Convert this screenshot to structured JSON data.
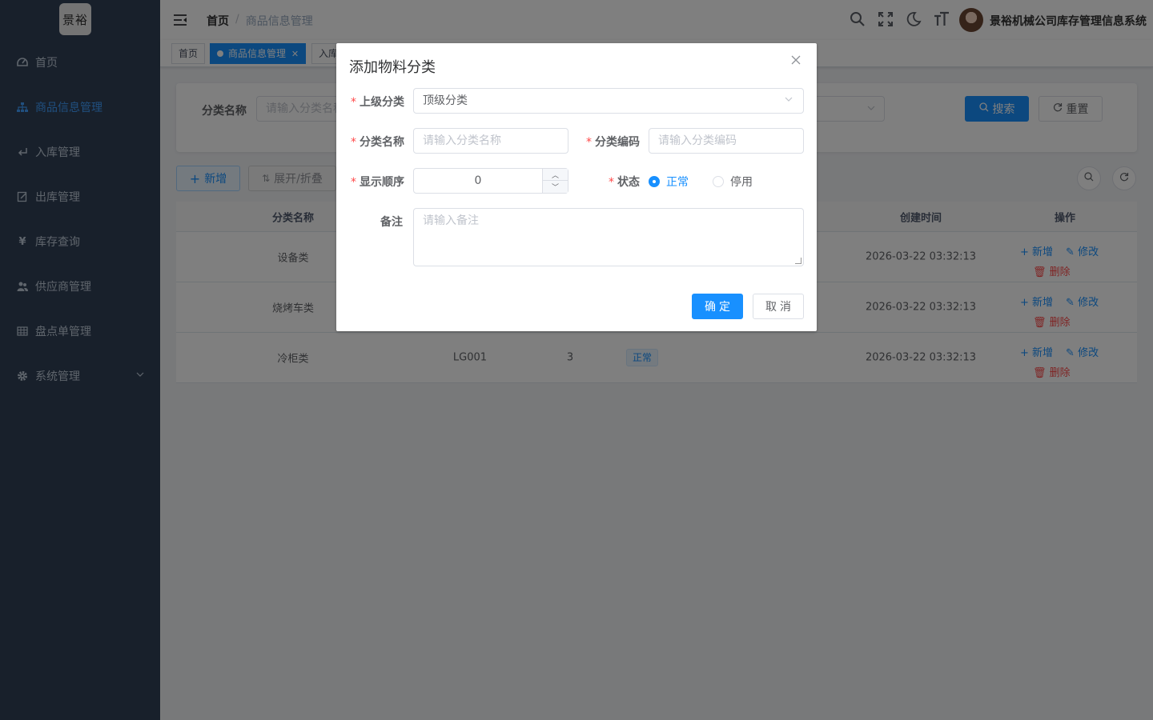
{
  "logo_text": "景裕",
  "sidebar": {
    "items": [
      {
        "label": "首页",
        "icon": "dashboard-icon"
      },
      {
        "label": "商品信息管理",
        "icon": "tree-icon"
      },
      {
        "label": "入库管理",
        "icon": "return-icon"
      },
      {
        "label": "出库管理",
        "icon": "edit-doc-icon"
      },
      {
        "label": "库存查询",
        "icon": "yen-icon"
      },
      {
        "label": "供应商管理",
        "icon": "people-icon"
      },
      {
        "label": "盘点单管理",
        "icon": "table-icon"
      },
      {
        "label": "系统管理",
        "icon": "gear-icon"
      }
    ],
    "active_index": 1
  },
  "header": {
    "breadcrumb_home": "首页",
    "breadcrumb_sep": "/",
    "breadcrumb_current": "商品信息管理",
    "system_name": "景裕机械公司库存管理信息系统"
  },
  "tags": {
    "items": [
      "首页",
      "商品信息管理",
      "入库"
    ]
  },
  "search": {
    "label": "分类名称",
    "placeholder": "请输入分类名称",
    "search_btn": "搜索",
    "reset_btn": "重置"
  },
  "toolbar": {
    "add_btn": "新增",
    "expand_btn": "展开/折叠"
  },
  "table": {
    "headers": {
      "name": "分类名称",
      "created": "创建时间",
      "ops": "操作"
    },
    "rows": [
      {
        "name": "设备类",
        "code": "",
        "order": "",
        "status": "",
        "created": "2026-03-22 03:32:13"
      },
      {
        "name": "烧烤车类",
        "code": "",
        "order": "",
        "status": "",
        "created": "2026-03-22 03:32:13"
      },
      {
        "name": "冷柜类",
        "code": "LG001",
        "order": "3",
        "status": "正常",
        "created": "2026-03-22 03:32:13"
      }
    ],
    "op_add": "新增",
    "op_edit": "修改",
    "op_delete": "删除"
  },
  "dialog": {
    "title": "添加物料分类",
    "required_mark": "*",
    "parent_label": "上级分类",
    "parent_value": "顶级分类",
    "name_label": "分类名称",
    "name_placeholder": "请输入分类名称",
    "code_label": "分类编码",
    "code_placeholder": "请输入分类编码",
    "order_label": "显示顺序",
    "order_value": "0",
    "status_label": "状态",
    "status_options": [
      "正常",
      "停用"
    ],
    "status_selected": "正常",
    "remark_label": "备注",
    "remark_placeholder": "请输入备注",
    "confirm_btn": "确定",
    "cancel_btn": "取消"
  },
  "colors": {
    "primary": "#1890ff",
    "sidebar_bg": "#304156",
    "danger": "#ff4949"
  }
}
